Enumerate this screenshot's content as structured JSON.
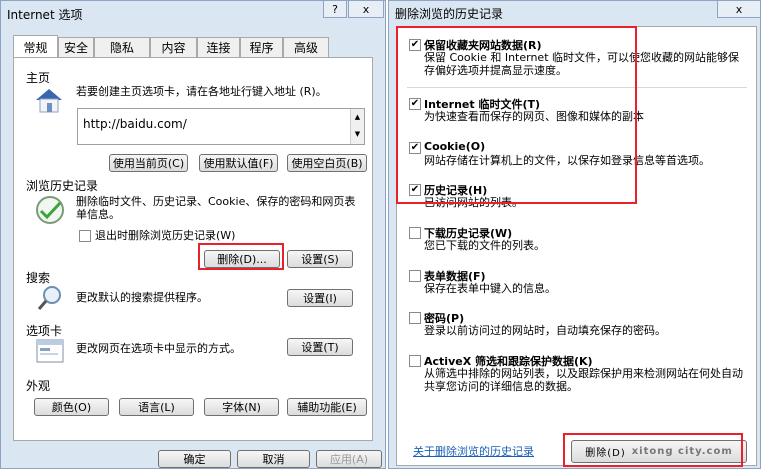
{
  "left": {
    "title": "Internet 选项",
    "tabs": [
      "常规",
      "安全",
      "隐私",
      "内容",
      "连接",
      "程序",
      "高级"
    ],
    "homepage": {
      "section": "主页",
      "instruction": "若要创建主页选项卡，请在各地址行键入地址 (R)。",
      "url": "http://baidu.com/",
      "buttons": [
        "使用当前页(C)",
        "使用默认值(F)",
        "使用空白页(B)"
      ]
    },
    "history": {
      "section": "浏览历史记录",
      "desc": "删除临时文件、历史记录、Cookie、保存的密码和网页表单信息。",
      "checkbox": "退出时删除浏览历史记录(W)",
      "delete_btn": "删除(D)...",
      "settings_btn": "设置(S)"
    },
    "search": {
      "section": "搜索",
      "desc": "更改默认的搜索提供程序。",
      "settings_btn": "设置(I)"
    },
    "tabsec": {
      "section": "选项卡",
      "desc": "更改网页在选项卡中显示的方式。",
      "settings_btn": "设置(T)"
    },
    "appearance": {
      "section": "外观",
      "buttons": [
        "颜色(O)",
        "语言(L)",
        "字体(N)",
        "辅助功能(E)"
      ]
    },
    "footer": [
      "确定",
      "取消",
      "应用(A)"
    ],
    "help_icon": "?",
    "close_icon": "x"
  },
  "right": {
    "title": "删除浏览的历史记录",
    "close_icon": "x",
    "items": [
      {
        "label": "保留收藏夹网站数据(R)",
        "desc": "保留 Cookie 和 Internet 临时文件，可以使您收藏的网站能够保存偏好选项并提高显示速度。",
        "checked": true
      },
      {
        "label": "Internet 临时文件(T)",
        "desc": "为快速查看而保存的网页、图像和媒体的副本",
        "checked": true
      },
      {
        "label": "Cookie(O)",
        "desc": "网站存储在计算机上的文件，以保存如登录信息等首选项。",
        "checked": true
      },
      {
        "label": "历史记录(H)",
        "desc": "已访问网站的列表。",
        "checked": true
      },
      {
        "label": "下载历史记录(W)",
        "desc": "您已下载的文件的列表。",
        "checked": false
      },
      {
        "label": "表单数据(F)",
        "desc": "保存在表单中键入的信息。",
        "checked": false
      },
      {
        "label": "密码(P)",
        "desc": "登录以前访问过的网站时，自动填充保存的密码。",
        "checked": false
      },
      {
        "label": "ActiveX 筛选和跟踪保护数据(K)",
        "desc": "从筛选中排除的网站列表，以及跟踪保护用来检测网站在何处自动共享您访问的详细信息的数据。",
        "checked": false
      }
    ],
    "link": "关于删除浏览的历史记录",
    "delete_btn": "删除(D)",
    "watermark": "xitong city.com"
  }
}
